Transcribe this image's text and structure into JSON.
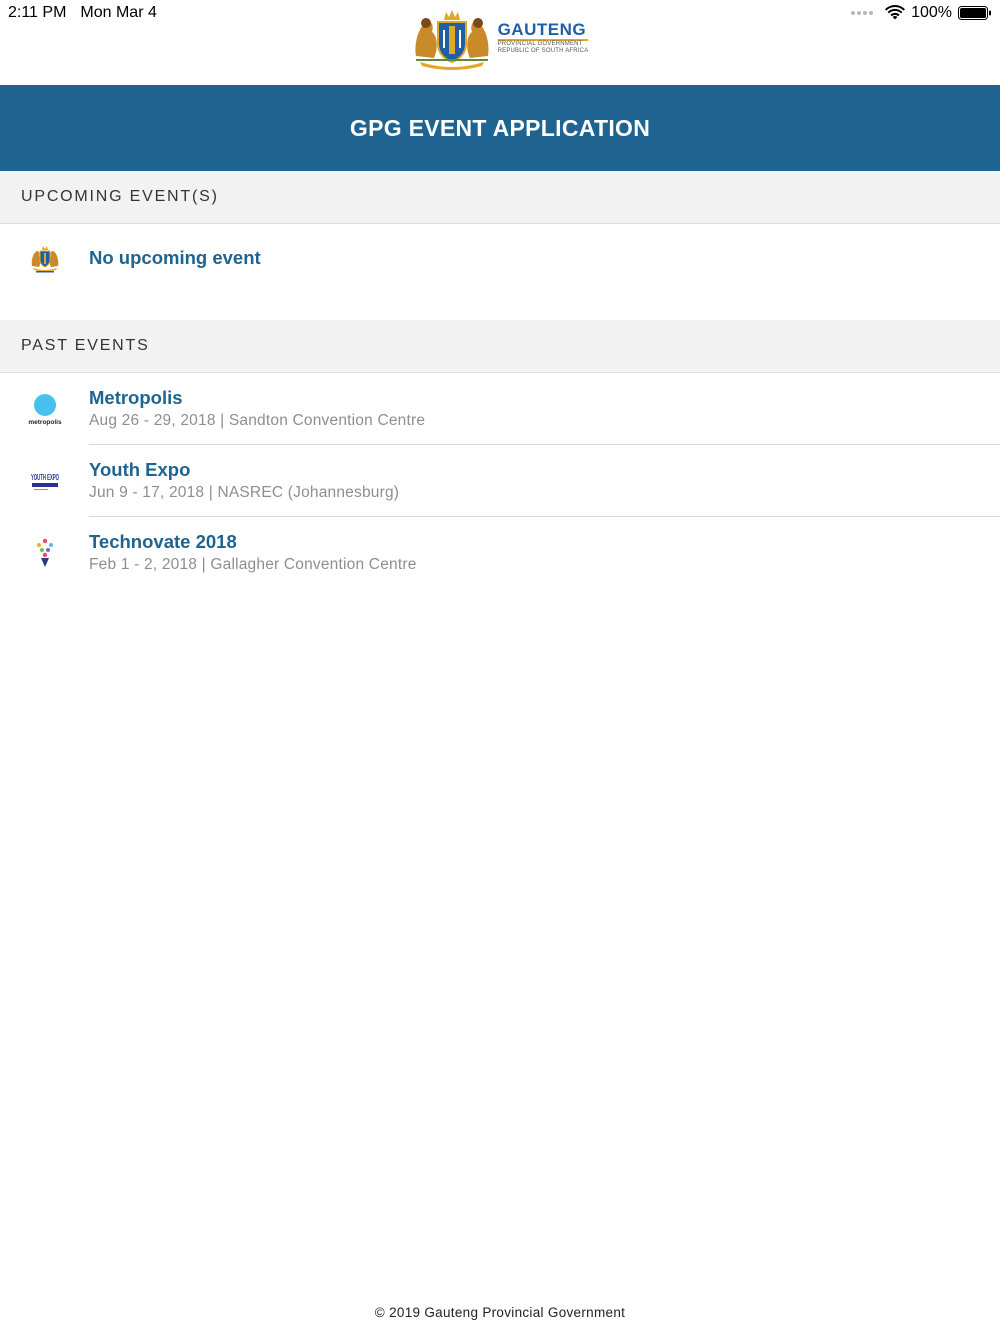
{
  "status_bar": {
    "time": "2:11 PM",
    "date": "Mon Mar 4",
    "battery": "100%",
    "icons": [
      "cellular-signal-icon",
      "wifi-icon",
      "battery-icon"
    ]
  },
  "logo": {
    "title": "GAUTENG",
    "subtitle_1": "PROVINCIAL GOVERNMENT",
    "subtitle_2": "REPUBLIC OF SOUTH AFRICA",
    "icon": "coat-of-arms-icon"
  },
  "header": {
    "title": "GPG EVENT APPLICATION"
  },
  "upcoming": {
    "section_label": "UPCOMING EVENT(S)",
    "empty_message": "No upcoming event",
    "icon": "gauteng-crest-icon"
  },
  "past": {
    "section_label": "PAST EVENTS",
    "items": [
      {
        "name": "Metropolis",
        "meta": "Aug 26 - 29, 2018 | Sandton Convention Centre",
        "logo_text": "metropolis",
        "icon": "metropolis-logo-icon"
      },
      {
        "name": "Youth Expo",
        "meta": "Jun 9 - 17, 2018 | NASREC (Johannesburg)",
        "logo_text": "YOUTH EXPO",
        "icon": "youth-expo-logo-icon"
      },
      {
        "name": "Technovate 2018",
        "meta": "Feb 1 - 2, 2018 | Gallagher Convention Centre",
        "icon": "technovate-logo-icon"
      }
    ]
  },
  "footer": {
    "text": "© 2019 Gauteng Provincial Government"
  },
  "colors": {
    "primary": "#1f6491",
    "logo_blue": "#1f5fa8",
    "section_bg": "#f2f2f2",
    "meta_text": "#8e8e8e",
    "metropolis_dot": "#47c1f0"
  }
}
